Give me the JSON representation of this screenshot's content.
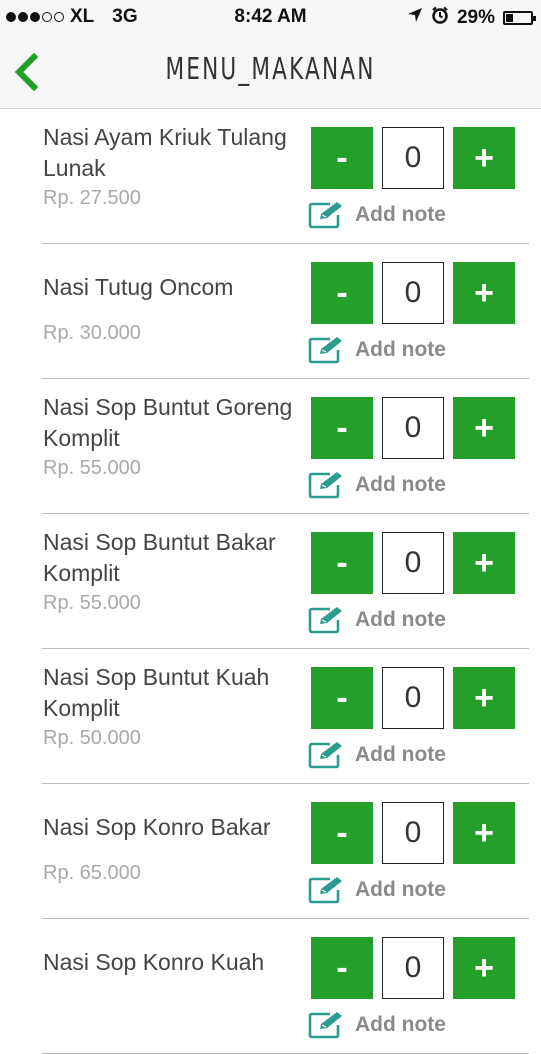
{
  "status_bar": {
    "carrier": "XL",
    "network": "3G",
    "time": "8:42 AM",
    "battery": "29%",
    "battery_level": 0.29,
    "signal_filled": 3,
    "signal_total": 5
  },
  "nav": {
    "title": "MENU_MAKANAN",
    "back_icon": "chevron-left-icon"
  },
  "colors": {
    "accent": "#24a02a",
    "note_icon": "#2a9d8f"
  },
  "qty_controls": {
    "minus": "-",
    "plus": "+"
  },
  "add_note_label": "Add note",
  "items": [
    {
      "name": "Nasi Ayam Kriuk Tulang Lunak",
      "price": "Rp. 27.500",
      "qty": "0"
    },
    {
      "name": "Nasi Tutug Oncom",
      "price": "Rp. 30.000",
      "qty": "0"
    },
    {
      "name": "Nasi Sop Buntut Goreng Komplit",
      "price": "Rp. 55.000",
      "qty": "0"
    },
    {
      "name": "Nasi Sop Buntut Bakar Komplit",
      "price": "Rp. 55.000",
      "qty": "0"
    },
    {
      "name": "Nasi Sop Buntut Kuah Komplit",
      "price": "Rp. 50.000",
      "qty": "0"
    },
    {
      "name": "Nasi Sop Konro Bakar",
      "price": "Rp. 65.000",
      "qty": "0"
    },
    {
      "name": "Nasi Sop Konro Kuah",
      "price": "",
      "qty": "0"
    }
  ]
}
